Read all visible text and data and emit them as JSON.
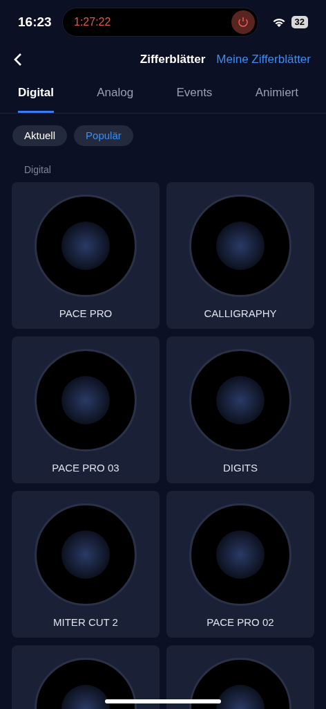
{
  "status_bar": {
    "time": "16:23",
    "activity_timer": "1:27:22",
    "battery": "32"
  },
  "header": {
    "title": "Zifferblätter",
    "action": "Meine Zifferblätter"
  },
  "tabs": [
    {
      "label": "Digital",
      "selected": true
    },
    {
      "label": "Analog",
      "selected": false
    },
    {
      "label": "Events",
      "selected": false
    },
    {
      "label": "Animiert",
      "selected": false
    }
  ],
  "filters": [
    {
      "label": "Aktuell",
      "selected": false
    },
    {
      "label": "Populär",
      "selected": true
    }
  ],
  "section_title": "Digital",
  "watch_faces": [
    {
      "kind": "full",
      "name": "PACE PRO"
    },
    {
      "kind": "full",
      "name": "CALLIGRAPHY"
    },
    {
      "kind": "full",
      "name": "PACE PRO 03"
    },
    {
      "kind": "full",
      "name": "DIGITS"
    },
    {
      "kind": "full",
      "name": "MITER CUT 2"
    },
    {
      "kind": "full",
      "name": "PACE PRO 02"
    },
    {
      "kind": "partial"
    },
    {
      "kind": "partial"
    }
  ]
}
